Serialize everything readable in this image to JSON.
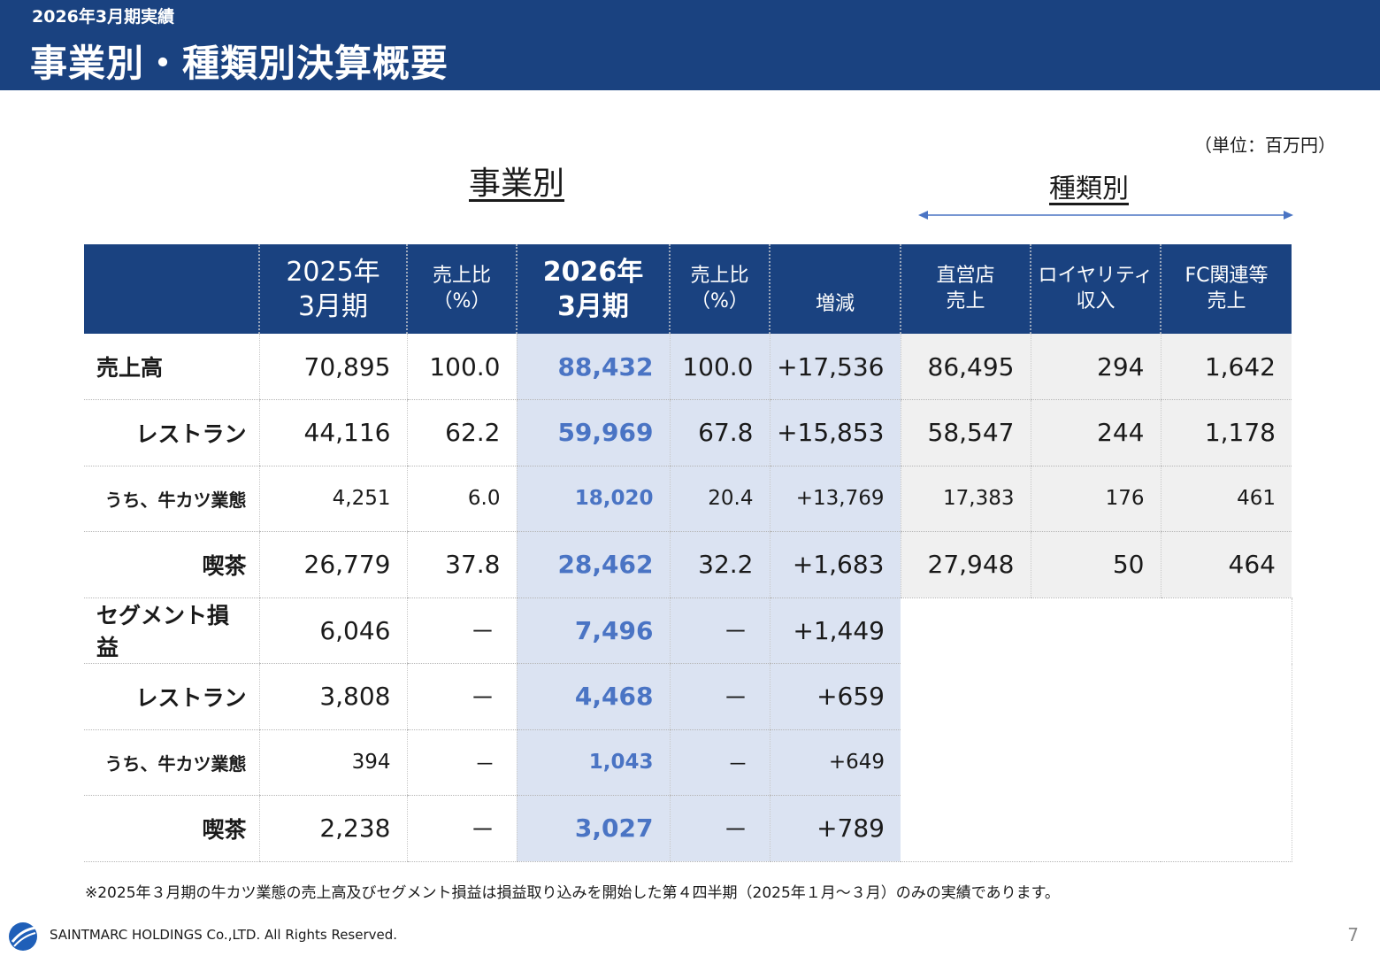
{
  "header": {
    "subtitle": "2026年3月期実績",
    "title": "事業別・種類別決算概要"
  },
  "unit": "（単位：百万円）",
  "section_business": "事業別",
  "section_type": "種類別",
  "columns": [
    "",
    "2025年\n3月期",
    "売上比\n（%）",
    "2026年\n3月期",
    "売上比\n（%）",
    "増減",
    "直営店\n売上",
    "ロイヤリティ\n収入",
    "FC関連等\n売上"
  ],
  "rows": [
    {
      "label": "売上高",
      "values": [
        "70,895",
        "100.0",
        "88,432",
        "100.0",
        "+17,536",
        "86,495",
        "294",
        "1,642"
      ]
    },
    {
      "label": "レストラン",
      "values": [
        "44,116",
        "62.2",
        "59,969",
        "67.8",
        "+15,853",
        "58,547",
        "244",
        "1,178"
      ]
    },
    {
      "label": "うち、牛カツ業態",
      "values": [
        "4,251",
        "6.0",
        "18,020",
        "20.4",
        "+13,769",
        "17,383",
        "176",
        "461"
      ]
    },
    {
      "label": "喫茶",
      "values": [
        "26,779",
        "37.8",
        "28,462",
        "32.2",
        "+1,683",
        "27,948",
        "50",
        "464"
      ]
    },
    {
      "label": "セグメント損益",
      "values": [
        "6,046",
        "－",
        "7,496",
        "－",
        "+1,449"
      ]
    },
    {
      "label": "レストラン",
      "values": [
        "3,808",
        "－",
        "4,468",
        "－",
        "+659"
      ]
    },
    {
      "label": "うち、牛カツ業態",
      "values": [
        "394",
        "－",
        "1,043",
        "－",
        "+649"
      ]
    },
    {
      "label": "喫茶",
      "values": [
        "2,238",
        "－",
        "3,027",
        "－",
        "+789"
      ]
    }
  ],
  "note": "※2025年３月期の牛カツ業態の売上高及びセグメント損益は損益取り込みを開始した第４四半期（2025年１月～３月）のみの実績であります。",
  "footer": "SAINTMARC HOLDINGS Co.,LTD. All Rights Reserved.",
  "page_number": "7",
  "colors": {
    "header_bg": "#1a4280",
    "highlight_bg": "#dbe3f2",
    "highlight_text": "#4a74c4",
    "gray_bg": "#f0f0f0"
  }
}
